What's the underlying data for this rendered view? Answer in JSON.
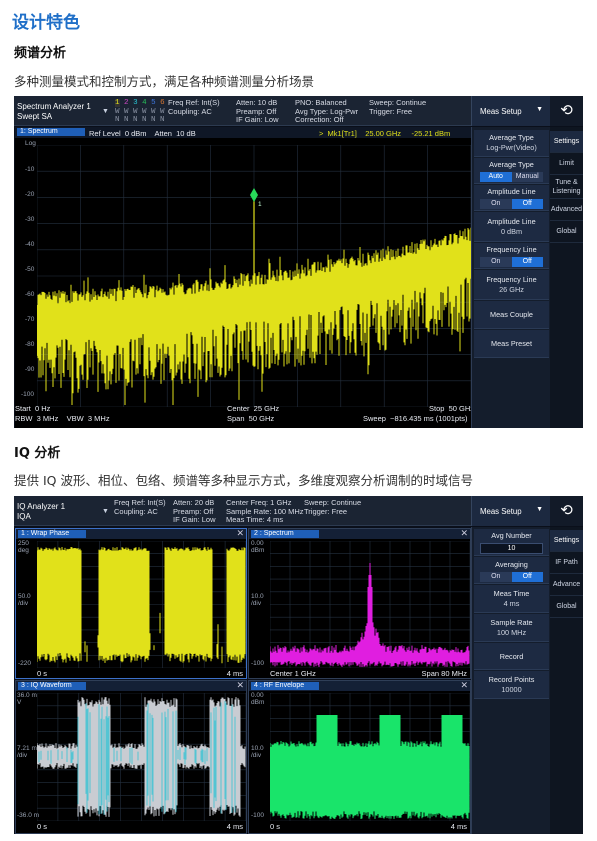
{
  "heading": "设计特色",
  "section1": {
    "title": "频谱分析",
    "desc": "多种测量模式和控制方式，满足各种频谱测量分析场景"
  },
  "section2": {
    "title": "IQ 分析",
    "desc": "提供 IQ 波形、相位、包络、频谱等多种显示方式，多维度观察分析调制的时域信号"
  },
  "colors": {
    "trace_yellow": "#e1e11a",
    "trace_magenta": "#e01ee0",
    "trace_green": "#19e46a",
    "trace_gray": "#c9ccd2",
    "trace_cyan": "#37c3d4",
    "accent_blue": "#1f6fd6",
    "marker_green": "#28d95a"
  },
  "sa": {
    "title": "Spectrum Analyzer 1",
    "mode": "Swept SA",
    "trace_nums": [
      "1",
      "2",
      "3",
      "4",
      "5",
      "6"
    ],
    "trace_row2": "W W W W W W",
    "trace_row3": "N N N N N N",
    "info1": "Freq Ref: Int(S)\nCoupling: AC",
    "info2": "Atten: 10 dB\nPreamp: Off\nIF Gain: Low",
    "info3": "PNO: Balanced\nAvg Type: Log-Pwr\nCorrection: Off",
    "info4": "Sweep: Continue\nTrigger: Free",
    "meas_setup": "Meas Setup",
    "window_label": "1: Spectrum",
    "ref_level": "Ref Level  0 dBm    Atten  10 dB",
    "marker_readout": ">  Mk1[Tr1]    25.00 GHz     -25.21 dBm",
    "log_label": "Log",
    "y_ticks": [
      "-10",
      "-20",
      "-30",
      "-40",
      "-50",
      "-60",
      "-70",
      "-80",
      "-90",
      "-100"
    ],
    "marker_num": "1",
    "footer": {
      "start": "Start  0 Hz",
      "center": "Center  25 GHz",
      "stop": "Stop  50 GHz",
      "rbw": "RBW  3 MHz    VBW  3 MHz",
      "span": "Span  50 GHz",
      "sweep": "Sweep  ~816.435 ms (1001pts)"
    },
    "panel": {
      "avg_type_label": "Average Type",
      "avg_type_value": "Log-Pwr(Video)",
      "avg_type2_label": "Average Type",
      "auto": "Auto",
      "manual": "Manual",
      "amp_hold_label": "Amplitude Line",
      "on": "On",
      "off": "Off",
      "amp_line_label": "Amplitude Line",
      "amp_line_value": "0 dBm",
      "freq_hold_label": "Frequency Line",
      "freq_line_label": "Frequency Line",
      "freq_line_value": "26 GHz",
      "meas_couple": "Meas Couple",
      "meas_preset": "Meas Preset"
    },
    "tabs": [
      "Settings",
      "Limit",
      "Tune & Listening",
      "Advanced",
      "Global"
    ]
  },
  "iq": {
    "title": "IQ Analyzer 1",
    "mode": "IQA",
    "info1": "Freq Ref: Int(S)\nCoupling: AC",
    "info2": "Atten: 20 dB\nPreamp: Off\nIF Gain: Low",
    "info3": "Center Freq: 1 GHz\nSample Rate: 100 MHz\nMeas Time: 4 ms",
    "info4": "Sweep: Continue\nTrigger: Free",
    "meas_setup": "Meas Setup",
    "windows": [
      {
        "label": "1 : Wrap Phase",
        "y_top": "250\ndeg",
        "y_mid": "50.0\n/div",
        "y_bot": "-220",
        "x_left": "0 s",
        "x_right": "4 ms"
      },
      {
        "label": "2 : Spectrum",
        "y_top": "0.00\ndBm",
        "y_mid": "10.0\n/div",
        "y_bot": "-100",
        "x_left": "Center 1 GHz",
        "x_right": "Span 80 MHz"
      },
      {
        "label": "3 : IQ Waveform",
        "y_top": "36.0 m\nV",
        "y_mid": "7.21 m\n/div",
        "y_bot": "-36.0 m",
        "x_left": "0 s",
        "x_right": "4 ms"
      },
      {
        "label": "4 : RF Envelope",
        "y_top": "0.00\ndBm",
        "y_mid": "10.0\n/div",
        "y_bot": "-100",
        "x_left": "0 s",
        "x_right": "4 ms"
      }
    ],
    "panel": {
      "avg_number_label": "Avg Number",
      "avg_number_value": "10",
      "averaging_label": "Averaging",
      "on": "On",
      "off": "Off",
      "meas_time_label": "Meas Time",
      "meas_time_value": "4 ms",
      "sample_rate_label": "Sample Rate",
      "sample_rate_value": "100 MHz",
      "record": "Record",
      "record_points_label": "Record Points",
      "record_points_value": "10000"
    },
    "tabs": [
      "Settings",
      "IF Path",
      "Advance",
      "Global"
    ]
  }
}
